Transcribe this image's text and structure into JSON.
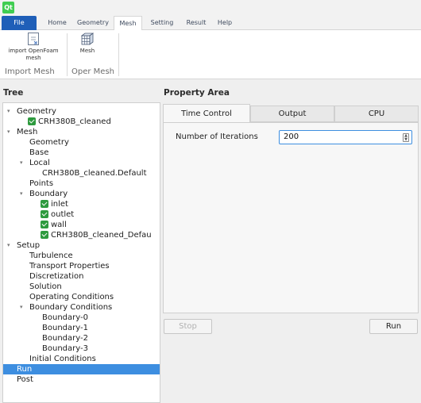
{
  "app": {
    "logo_text": "Qt"
  },
  "ribbon": {
    "tabs": [
      "File",
      "Home",
      "Geometry",
      "Mesh",
      "Setting",
      "Result",
      "Help"
    ],
    "active_tab": "Mesh",
    "buttons": {
      "import_openfoam_line1": "import OpenFoam",
      "import_openfoam_line2": "mesh",
      "mesh": "Mesh"
    },
    "groups": [
      "Import Mesh",
      "Oper Mesh"
    ]
  },
  "tree": {
    "header": "Tree",
    "items": [
      "Geometry",
      "CRH380B_cleaned",
      "Mesh",
      "Geometry",
      "Base",
      "Local",
      "CRH380B_cleaned.Default",
      "Points",
      "Boundary",
      "inlet",
      "outlet",
      "wall",
      "CRH380B_cleaned_Defau",
      "Setup",
      "Turbulence",
      "Transport Properties",
      "Discretization",
      "Solution",
      "Operating Conditions",
      "Boundary Conditions",
      "Boundary-0",
      "Boundary-1",
      "Boundary-2",
      "Boundary-3",
      "Initial Conditions",
      "Run",
      "Post"
    ],
    "selected": "Run"
  },
  "property": {
    "header": "Property Area",
    "tabs": [
      "Time Control",
      "Output",
      "CPU"
    ],
    "active_tab": "Time Control",
    "iterations_label": "Number of Iterations",
    "iterations_value": "200",
    "stop_label": "Stop",
    "run_label": "Run"
  },
  "colors": {
    "accent": "#3d8ee0",
    "file_tab": "#1f5fb8",
    "checkbox": "#2e9a3e"
  }
}
